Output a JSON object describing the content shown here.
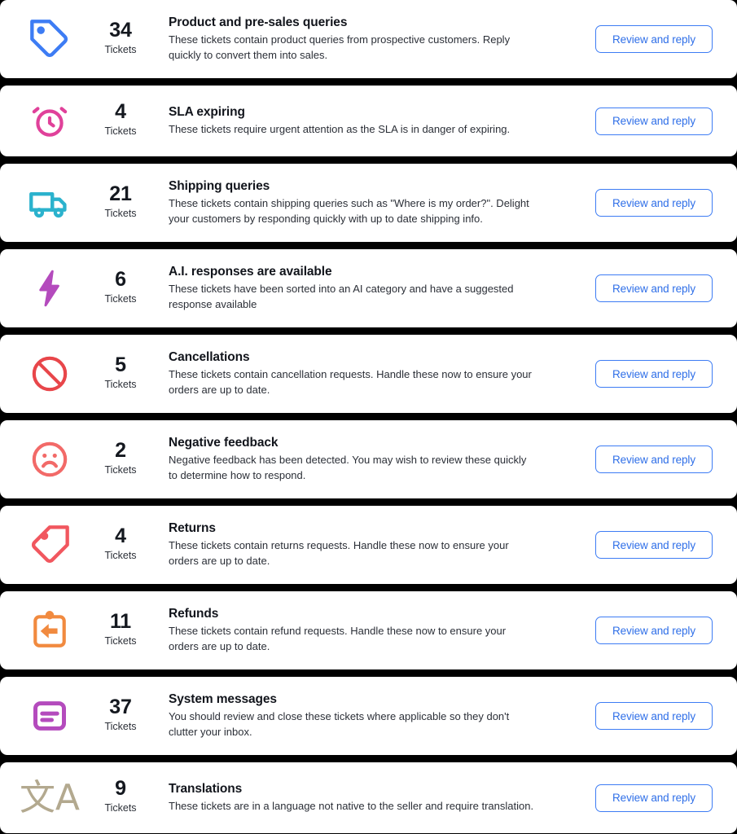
{
  "page": {
    "background_color": "#000000",
    "card_background": "#ffffff",
    "accent_button_color": "#3d7cf4"
  },
  "common": {
    "tickets_label": "Tickets",
    "review_button_label": "Review and reply"
  },
  "rows": [
    {
      "icon": "price-tag-icon",
      "icon_color": "#3d7cf4",
      "count": "34",
      "tickets_label": "Tickets",
      "title": "Product and pre-sales queries",
      "description": "These tickets contain product queries from prospective customers. Reply quickly to convert them into sales.",
      "button_label": "Review and reply"
    },
    {
      "icon": "alarm-clock-icon",
      "icon_color": "#e0419a",
      "count": "4",
      "tickets_label": "Tickets",
      "title": "SLA expiring",
      "description": "These tickets require urgent attention as the SLA is in danger of expiring.",
      "button_label": "Review and reply"
    },
    {
      "icon": "delivery-truck-icon",
      "icon_color": "#2bb2cd",
      "count": "21",
      "tickets_label": "Tickets",
      "title": "Shipping queries",
      "description": "These tickets contain shipping queries such as \"Where is my order?\". Delight your customers by responding quickly with up to date shipping info.",
      "button_label": "Review and reply"
    },
    {
      "icon": "lightning-bolt-icon",
      "icon_color": "#b44bbd",
      "count": "6",
      "tickets_label": "Tickets",
      "title": "A.I. responses are available",
      "description": "These tickets have been sorted into an AI category and have a suggested response available",
      "button_label": "Review and reply"
    },
    {
      "icon": "prohibition-icon",
      "icon_color": "#e8464a",
      "count": "5",
      "tickets_label": "Tickets",
      "title": "Cancellations",
      "description": "These tickets contain cancellation requests. Handle these now to ensure your orders are up to date.",
      "button_label": "Review and reply"
    },
    {
      "icon": "sad-face-icon",
      "icon_color": "#f26a68",
      "count": "2",
      "tickets_label": "Tickets",
      "title": "Negative feedback",
      "description": "Negative feedback has been detected. You may wish to review these quickly to determine how to respond.",
      "button_label": "Review and reply"
    },
    {
      "icon": "returns-tag-icon",
      "icon_color": "#f1575f",
      "count": "4",
      "tickets_label": "Tickets",
      "title": "Returns",
      "description": "These tickets contain returns requests. Handle these now to ensure your orders are up to date.",
      "button_label": "Review and reply"
    },
    {
      "icon": "clipboard-back-arrow-icon",
      "icon_color": "#f18a3f",
      "count": "11",
      "tickets_label": "Tickets",
      "title": "Refunds",
      "description": "These tickets contain refund requests. Handle these now to ensure your orders are up to date.",
      "button_label": "Review and reply"
    },
    {
      "icon": "system-message-icon",
      "icon_color": "#b44bbd",
      "count": "37",
      "tickets_label": "Tickets",
      "title": "System messages",
      "description": "You should review and close these tickets where applicable so they don't clutter your inbox.",
      "button_label": "Review and reply"
    },
    {
      "icon": "translate-icon",
      "icon_color": "#b3a98f",
      "count": "9",
      "tickets_label": "Tickets",
      "title": "Translations",
      "description": "These tickets are in a language not native to the seller and require translation.",
      "button_label": "Review and reply",
      "glyph": "文A"
    }
  ]
}
